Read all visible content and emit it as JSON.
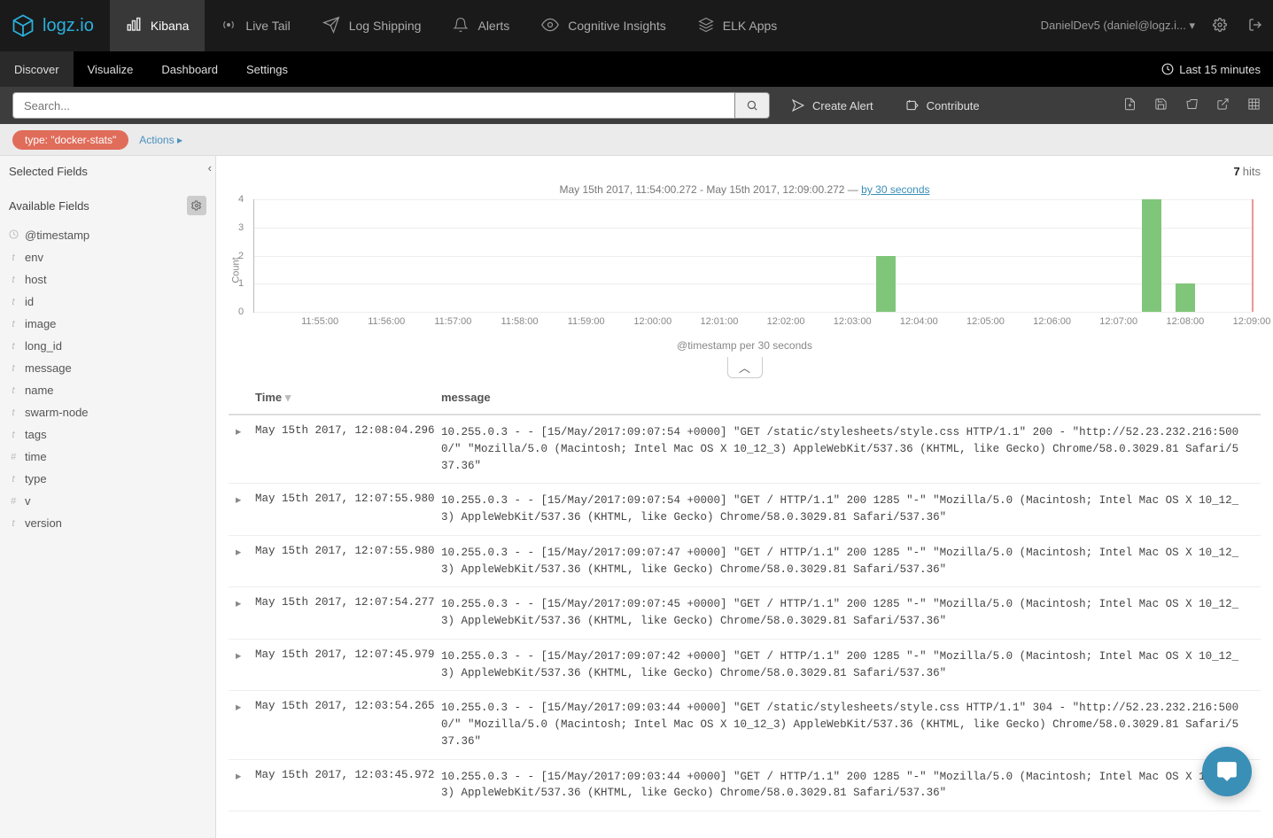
{
  "brand": "logz.io",
  "nav": [
    {
      "label": "Kibana",
      "active": true,
      "icon": "bars"
    },
    {
      "label": "Live Tail",
      "active": false,
      "icon": "radio"
    },
    {
      "label": "Log Shipping",
      "active": false,
      "icon": "plane"
    },
    {
      "label": "Alerts",
      "active": false,
      "icon": "bell"
    },
    {
      "label": "Cognitive Insights",
      "active": false,
      "icon": "eye"
    },
    {
      "label": "ELK Apps",
      "active": false,
      "icon": "stack"
    }
  ],
  "user_label": "DanielDev5 (daniel@logz.i...",
  "tabs": [
    "Discover",
    "Visualize",
    "Dashboard",
    "Settings"
  ],
  "active_tab": "Discover",
  "time_picker": "Last 15 minutes",
  "search": {
    "placeholder": "Search..."
  },
  "query_actions": {
    "create_alert": "Create Alert",
    "contribute": "Contribute"
  },
  "filter_pill": "type: \"docker-stats\"",
  "actions_link": "Actions",
  "sidebar": {
    "selected_label": "Selected Fields",
    "available_label": "Available Fields",
    "fields": [
      {
        "t": "clock",
        "name": "@timestamp"
      },
      {
        "t": "t",
        "name": "env"
      },
      {
        "t": "t",
        "name": "host"
      },
      {
        "t": "t",
        "name": "id"
      },
      {
        "t": "t",
        "name": "image"
      },
      {
        "t": "t",
        "name": "long_id"
      },
      {
        "t": "t",
        "name": "message"
      },
      {
        "t": "t",
        "name": "name"
      },
      {
        "t": "t",
        "name": "swarm-node"
      },
      {
        "t": "t",
        "name": "tags"
      },
      {
        "t": "#",
        "name": "time"
      },
      {
        "t": "t",
        "name": "type"
      },
      {
        "t": "#",
        "name": "v"
      },
      {
        "t": "t",
        "name": "version"
      }
    ]
  },
  "hits": {
    "count": "7",
    "label": "hits"
  },
  "histo_caption_prefix": "May 15th 2017, 11:54:00.272 - May 15th 2017, 12:09:00.272 — ",
  "histo_caption_link": "by 30 seconds",
  "chart_data": {
    "type": "bar",
    "title": "",
    "xlabel": "@timestamp per 30 seconds",
    "ylabel": "Count",
    "ylim": [
      0,
      4
    ],
    "xticks": [
      "11:55:00",
      "11:56:00",
      "11:57:00",
      "11:58:00",
      "11:59:00",
      "12:00:00",
      "12:01:00",
      "12:02:00",
      "12:03:00",
      "12:04:00",
      "12:05:00",
      "12:06:00",
      "12:07:00",
      "12:08:00",
      "12:09:00"
    ],
    "series": [
      {
        "name": "count",
        "values": [
          {
            "bucket": "12:03:30",
            "count": 2
          },
          {
            "bucket": "12:07:30",
            "count": 4
          },
          {
            "bucket": "12:08:00",
            "count": 1
          }
        ]
      }
    ],
    "marker_time": "12:09:00"
  },
  "columns": {
    "time": "Time",
    "message": "message"
  },
  "rows": [
    {
      "time": "May 15th 2017, 12:08:04.296",
      "msg": "10.255.0.3 - - [15/May/2017:09:07:54 +0000] \"GET /static/stylesheets/style.css HTTP/1.1\" 200 - \"http://52.23.232.216:5000/\" \"Mozilla/5.0 (Macintosh; Intel Mac OS X 10_12_3) AppleWebKit/537.36 (KHTML, like Gecko) Chrome/58.0.3029.81 Safari/537.36\""
    },
    {
      "time": "May 15th 2017, 12:07:55.980",
      "msg": "10.255.0.3 - - [15/May/2017:09:07:54 +0000] \"GET / HTTP/1.1\" 200 1285 \"-\" \"Mozilla/5.0 (Macintosh; Intel Mac OS X 10_12_3) AppleWebKit/537.36 (KHTML, like Gecko) Chrome/58.0.3029.81 Safari/537.36\""
    },
    {
      "time": "May 15th 2017, 12:07:55.980",
      "msg": "10.255.0.3 - - [15/May/2017:09:07:47 +0000] \"GET / HTTP/1.1\" 200 1285 \"-\" \"Mozilla/5.0 (Macintosh; Intel Mac OS X 10_12_3) AppleWebKit/537.36 (KHTML, like Gecko) Chrome/58.0.3029.81 Safari/537.36\""
    },
    {
      "time": "May 15th 2017, 12:07:54.277",
      "msg": "10.255.0.3 - - [15/May/2017:09:07:45 +0000] \"GET / HTTP/1.1\" 200 1285 \"-\" \"Mozilla/5.0 (Macintosh; Intel Mac OS X 10_12_3) AppleWebKit/537.36 (KHTML, like Gecko) Chrome/58.0.3029.81 Safari/537.36\""
    },
    {
      "time": "May 15th 2017, 12:07:45.979",
      "msg": "10.255.0.3 - - [15/May/2017:09:07:42 +0000] \"GET / HTTP/1.1\" 200 1285 \"-\" \"Mozilla/5.0 (Macintosh; Intel Mac OS X 10_12_3) AppleWebKit/537.36 (KHTML, like Gecko) Chrome/58.0.3029.81 Safari/537.36\""
    },
    {
      "time": "May 15th 2017, 12:03:54.265",
      "msg": "10.255.0.3 - - [15/May/2017:09:03:44 +0000] \"GET /static/stylesheets/style.css HTTP/1.1\" 304 - \"http://52.23.232.216:5000/\" \"Mozilla/5.0 (Macintosh; Intel Mac OS X 10_12_3) AppleWebKit/537.36 (KHTML, like Gecko) Chrome/58.0.3029.81 Safari/537.36\""
    },
    {
      "time": "May 15th 2017, 12:03:45.972",
      "msg": "10.255.0.3 - - [15/May/2017:09:03:44 +0000] \"GET / HTTP/1.1\" 200 1285 \"-\" \"Mozilla/5.0 (Macintosh; Intel Mac OS X 10_12_3) AppleWebKit/537.36 (KHTML, like Gecko) Chrome/58.0.3029.81 Safari/537.36\""
    }
  ]
}
